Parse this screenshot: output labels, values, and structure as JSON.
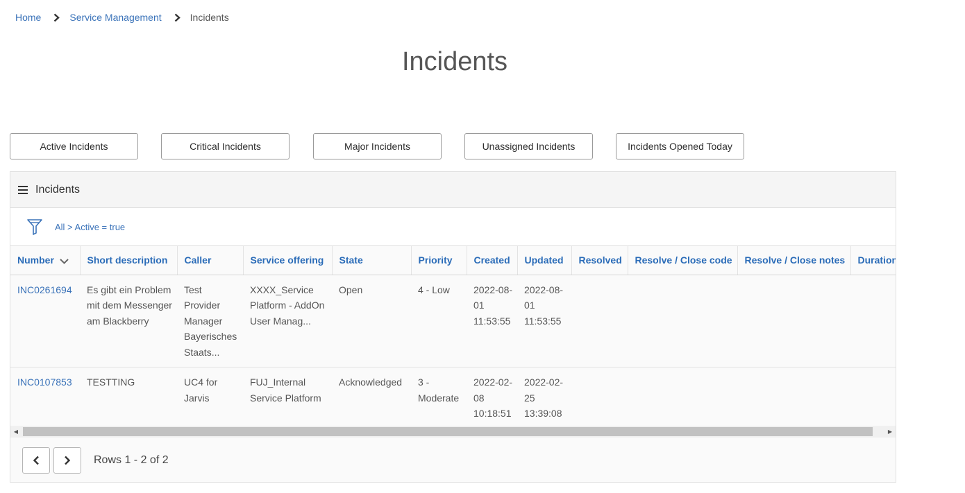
{
  "breadcrumb": {
    "home": "Home",
    "service_management": "Service Management",
    "current": "Incidents"
  },
  "page_title": "Incidents",
  "quick_filters": [
    "Active Incidents",
    "Critical Incidents",
    "Major Incidents",
    "Unassigned Incidents",
    "Incidents Opened Today"
  ],
  "list": {
    "title": "Incidents",
    "filter": "All > Active = true",
    "columns": [
      "Number",
      "Short description",
      "Caller",
      "Service offering",
      "State",
      "Priority",
      "Created",
      "Updated",
      "Resolved",
      "Resolve / Close code",
      "Resolve / Close notes",
      "Duration"
    ],
    "rows": [
      {
        "number": "INC0261694",
        "short_description": "Es gibt ein Problem mit dem Messenger am Blackberry",
        "caller": "Test Provider Manager Bayerisches Staats...",
        "service_offering": "XXXX_Service Platform - AddOn User Manag...",
        "state": "Open",
        "priority": "4 - Low",
        "created": "2022-08-01 11:53:55",
        "updated": "2022-08-01 11:53:55",
        "resolved": "",
        "close_code": "",
        "close_notes": "",
        "duration": ""
      },
      {
        "number": "INC0107853",
        "short_description": "TESTTING",
        "caller": "UC4 for Jarvis",
        "service_offering": "FUJ_Internal Service Platform",
        "state": "Acknowledged",
        "priority": "3 - Moderate",
        "created": "2022-02-08 10:18:51",
        "updated": "2022-02-25 13:39:08",
        "resolved": "",
        "close_code": "",
        "close_notes": "",
        "duration": ""
      }
    ]
  },
  "pagination": {
    "rows_info": "Rows 1 - 2 of 2"
  },
  "colors": {
    "link": "#3b73b9",
    "header_text": "#2b6cb8",
    "border": "#e0e0e0"
  }
}
